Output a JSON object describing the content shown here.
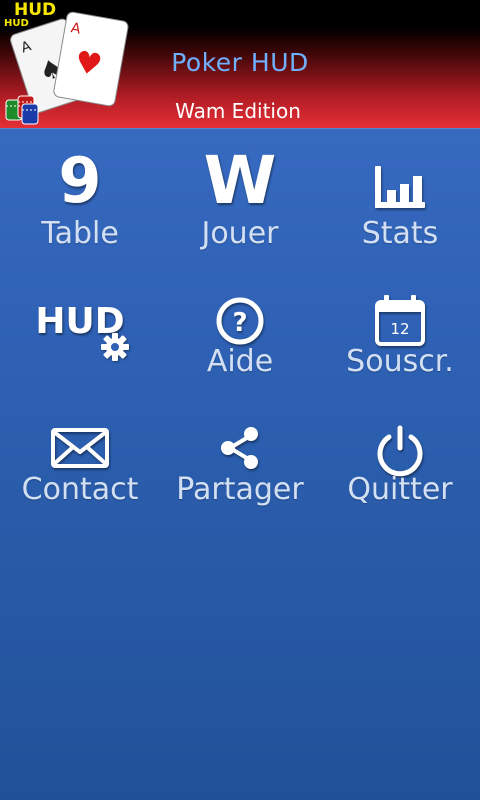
{
  "header": {
    "title": "Poker HUD",
    "subtitle": "Wam Edition",
    "logo_text_large": "HUD",
    "logo_text_small": "HUD",
    "logo_icon": "playing-cards-logo"
  },
  "menu": {
    "table": {
      "glyph": "9",
      "label": "Table",
      "icon": "nine-digit-icon"
    },
    "jouer": {
      "glyph": "W",
      "label": "Jouer",
      "icon": "w-letter-icon"
    },
    "stats": {
      "label": "Stats",
      "icon": "bar-chart-icon"
    },
    "hud": {
      "glyph": "HUD",
      "label": "",
      "icon": "hud-settings-icon"
    },
    "aide": {
      "label": "Aide",
      "icon": "help-circle-icon"
    },
    "souscr": {
      "calendar_day": "12",
      "label": "Souscr.",
      "icon": "calendar-icon"
    },
    "contact": {
      "label": "Contact",
      "icon": "envelope-icon"
    },
    "partager": {
      "label": "Partager",
      "icon": "share-icon"
    },
    "quitter": {
      "label": "Quitter",
      "icon": "power-icon"
    }
  },
  "colors": {
    "background_top": "#3b6fc6",
    "background_bottom": "#215198",
    "header_red": "#e52f36",
    "title_blue": "#6fb0ff",
    "label_color": "#d3e0f3"
  }
}
